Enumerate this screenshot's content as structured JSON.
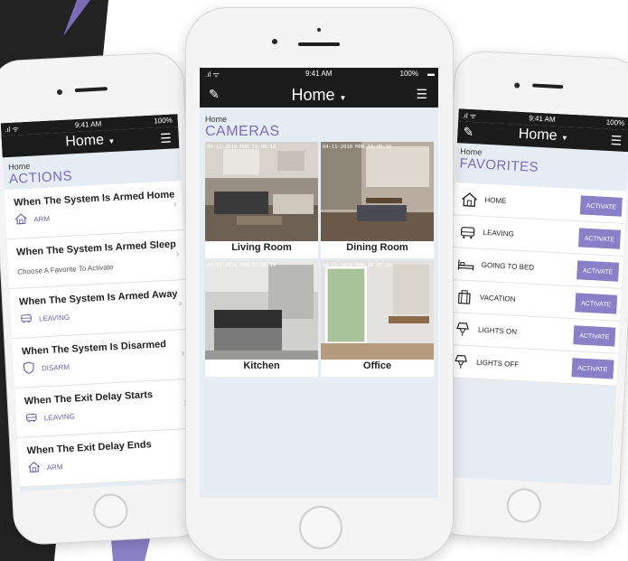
{
  "colors": {
    "accent": "#7b6bb8",
    "button": "#8a80c8",
    "navbar": "#1b1b1b",
    "screen_bg": "#e6ecf3",
    "bg_dark": "#232323"
  },
  "left_phone": {
    "status": {
      "time": "9:41 AM",
      "battery": "100%"
    },
    "nav_title": "Home",
    "breadcrumb": "Home",
    "section": "ACTIONS",
    "rows": [
      {
        "title": "When The System Is Armed Home",
        "icon": "home-icon",
        "label": "ARM"
      },
      {
        "title": "When The System Is Armed Sleep",
        "subtitle": "Choose A Favorite To Activate"
      },
      {
        "title": "When The System Is Armed Away",
        "icon": "car-icon",
        "label": "LEAVING"
      },
      {
        "title": "When The System Is Disarmed",
        "icon": "shield-icon",
        "label": "DISARM"
      },
      {
        "title": "When The Exit Delay Starts",
        "icon": "car-icon",
        "label": "LEAVING"
      },
      {
        "title": "When The Exit Delay Ends",
        "icon": "home-icon",
        "label": "ARM"
      }
    ]
  },
  "center_phone": {
    "status": {
      "time": "9:41 AM",
      "battery": "100%"
    },
    "nav_title": "Home",
    "breadcrumb": "Home",
    "section": "CAMERAS",
    "cameras": [
      {
        "name": "Living Room",
        "timestamp": "04-11-2018 MON 10:08:10"
      },
      {
        "name": "Dining Room",
        "timestamp": "04-11-2018 MON 10:08:10"
      },
      {
        "name": "Kitchen",
        "timestamp": "04-11-2018 MON 10:08:10"
      },
      {
        "name": "Office",
        "timestamp": "04-11-2018 MON 10:07:10"
      }
    ]
  },
  "right_phone": {
    "status": {
      "time": "9:41 AM",
      "battery": "100%"
    },
    "nav_title": "Home",
    "breadcrumb": "Home",
    "section": "FAVORITES",
    "favorites": [
      {
        "label": "HOME",
        "icon": "home-icon",
        "button": "ACTIVATE"
      },
      {
        "label": "LEAVING",
        "icon": "car-icon",
        "button": "ACTIVATE"
      },
      {
        "label": "GOING TO BED",
        "icon": "bed-icon",
        "button": "ACTIVATE"
      },
      {
        "label": "VACATION",
        "icon": "suitcase-icon",
        "button": "ACTIVATE"
      },
      {
        "label": "LIGHTS ON",
        "icon": "lamp-icon",
        "button": "ACTIVATE"
      },
      {
        "label": "LIGHTS OFF",
        "icon": "lamp-icon",
        "button": "ACTIVATE"
      }
    ]
  }
}
